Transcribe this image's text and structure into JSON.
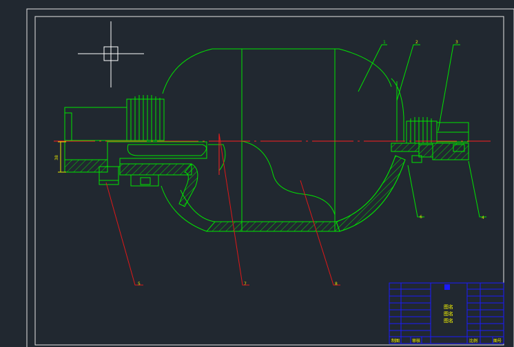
{
  "colors": {
    "background": "#212830",
    "frame": "#e6e6e6",
    "outline": "#00e600",
    "centerline": "#ff2020",
    "leader_red": "#e01818",
    "leader_green": "#00e600",
    "title_block": "#1a1aff",
    "title_text_yellow": "#ffff00"
  },
  "crosshair_cursor": {
    "icon": "crosshair-pick-box-icon"
  },
  "callouts": {
    "p1": "1",
    "p2": "2",
    "p3": "3",
    "p4": "4",
    "p5": "5",
    "p6": "6",
    "p7": "7",
    "p8": "8"
  },
  "dimension_value": "38",
  "title_block": {
    "center_labels": [
      "图名",
      "图名",
      "图名"
    ],
    "bottom_labels": [
      "制图",
      "审核",
      "比例",
      "图号"
    ]
  }
}
